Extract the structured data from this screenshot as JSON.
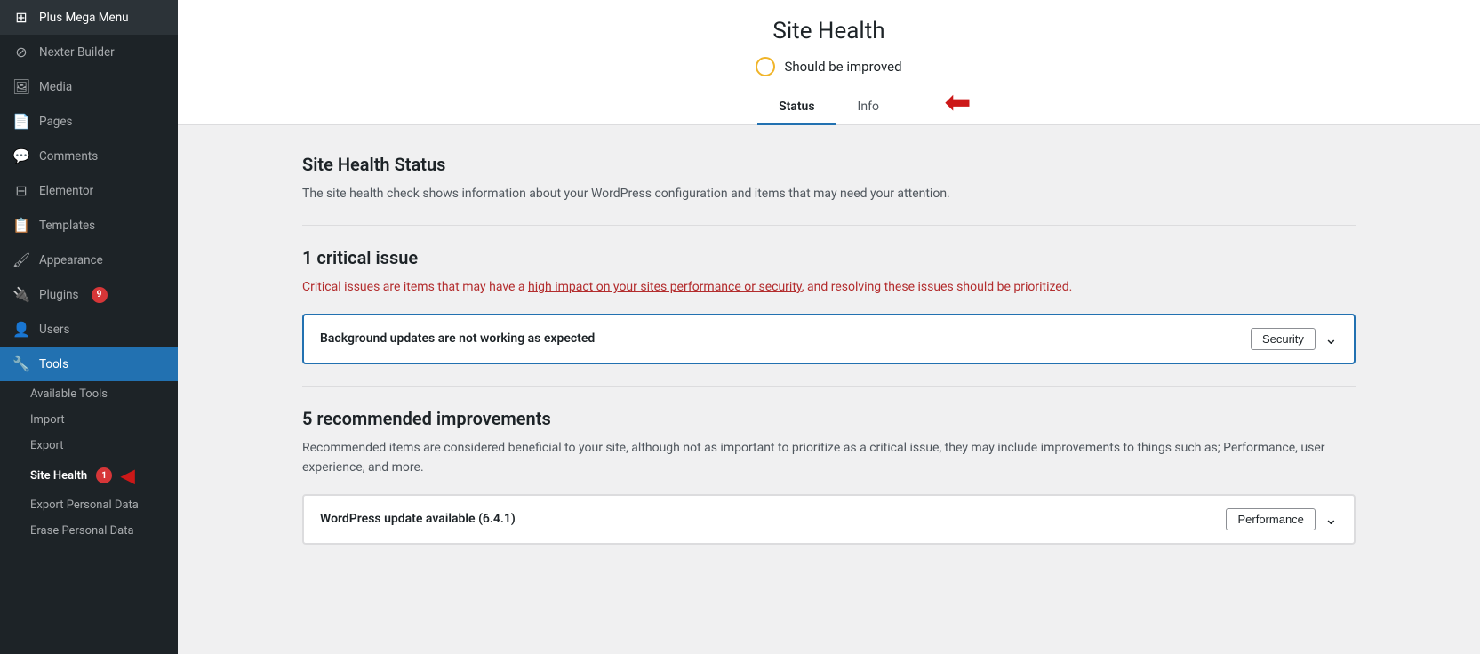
{
  "sidebar": {
    "items": [
      {
        "id": "plus-mega-menu",
        "label": "Plus Mega Menu",
        "icon": "⊞"
      },
      {
        "id": "nexter-builder",
        "label": "Nexter Builder",
        "icon": "⊘"
      },
      {
        "id": "media",
        "label": "Media",
        "icon": "🖼"
      },
      {
        "id": "pages",
        "label": "Pages",
        "icon": "📄"
      },
      {
        "id": "comments",
        "label": "Comments",
        "icon": "💬"
      },
      {
        "id": "elementor",
        "label": "Elementor",
        "icon": "⊟"
      },
      {
        "id": "templates",
        "label": "Templates",
        "icon": "📋"
      },
      {
        "id": "appearance",
        "label": "Appearance",
        "icon": "🖌"
      },
      {
        "id": "plugins",
        "label": "Plugins",
        "icon": "🔌",
        "badge": "9"
      },
      {
        "id": "users",
        "label": "Users",
        "icon": "👤"
      },
      {
        "id": "tools",
        "label": "Tools",
        "icon": "🔧",
        "active": true
      }
    ],
    "subItems": [
      {
        "id": "available-tools",
        "label": "Available Tools"
      },
      {
        "id": "import",
        "label": "Import"
      },
      {
        "id": "export",
        "label": "Export"
      },
      {
        "id": "site-health",
        "label": "Site Health",
        "badge": "1",
        "active": true
      },
      {
        "id": "export-personal-data",
        "label": "Export Personal Data"
      },
      {
        "id": "erase-personal-data",
        "label": "Erase Personal Data"
      }
    ]
  },
  "header": {
    "title": "Site Health",
    "status_label": "Should be improved",
    "tabs": [
      {
        "id": "status",
        "label": "Status",
        "active": true
      },
      {
        "id": "info",
        "label": "Info"
      }
    ]
  },
  "main": {
    "status_section": {
      "title": "Site Health Status",
      "description": "The site health check shows information about your WordPress configuration and items that may need your attention."
    },
    "critical_section": {
      "title": "1 critical issue",
      "description_start": "Critical issues are items that may have a ",
      "description_link": "high impact on your sites performance or security",
      "description_end": ", and resolving these issues should be prioritized.",
      "issue": {
        "title": "Background updates are not working as expected",
        "tag": "Security"
      }
    },
    "recommended_section": {
      "title": "5 recommended improvements",
      "description": "Recommended items are considered beneficial to your site, although not as important to prioritize as a critical issue, they may include improvements to things such as; Performance, user experience, and more.",
      "issue": {
        "title": "WordPress update available (6.4.1)",
        "tag": "Performance"
      }
    }
  }
}
